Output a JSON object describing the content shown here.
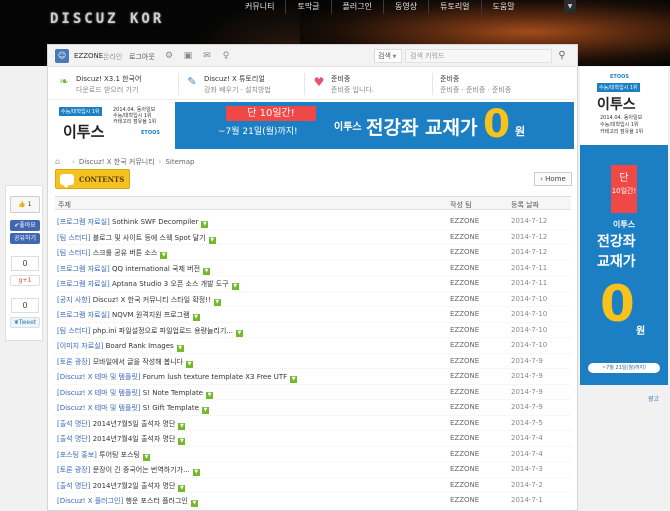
{
  "logo": "DISCUZ KOR",
  "topnav": {
    "items": [
      "커뮤니티",
      "토막글",
      "플러그인",
      "동영상",
      "튜토리얼",
      "도움말"
    ]
  },
  "toolbar": {
    "username": "EZZONE",
    "status": "온라인",
    "logout": "로그아웃",
    "search_scope": "검색",
    "search_placeholder": "검색 키워드"
  },
  "infobar": [
    {
      "title": "Discuz! X3.1 한국어",
      "subtitle": "다운로드 받으러 가기",
      "icon": "leaf-icon",
      "color": "#6cb33e"
    },
    {
      "title": "Discuz! X 튜토리얼",
      "subtitle": "강좌 배우기 · 설치방법",
      "icon": "chat-icon",
      "color": "#3f82c4"
    },
    {
      "title": "준비중",
      "subtitle": "준비중 입니다.",
      "icon": "heart-icon",
      "color": "#e8536b"
    },
    {
      "title": "준비중",
      "subtitle": "준비중 · 준비중 · 준비중"
    }
  ],
  "banner": {
    "badge": "수능/대학입시 1위",
    "year_line1": "2014.04. 동아일보",
    "year_line2": "수능/대학입시 1위",
    "year_line3": "카테고리 점유율 1위",
    "brand": "이투스",
    "etoos_small": "ETOOS",
    "ribbon_top": "단 10일간!",
    "ribbon_bottom": "~7월 21일(월)까지!",
    "brand2": "이투스",
    "headline": "전강좌 교재가",
    "zero": "0",
    "won": "원"
  },
  "side_ad": {
    "etoos_small": "ETOOS",
    "badge": "수능/대학입시 1위",
    "brand": "이투스",
    "year_line1": "2014.04. 동아일보",
    "year_line2": "수능/대학입시 1위",
    "year_line3": "카테고리 점유율 1위",
    "ribbon1": "단",
    "ribbon2": "10일간!",
    "brand2": "이투스",
    "headline1": "전강좌",
    "headline2": "교재가",
    "zero": "0",
    "won": "원",
    "deadline": "~7월 21일(월)까지!",
    "link": "광고"
  },
  "breadcrumb": [
    "Discuz! X 한국 커뮤니티",
    "Sitemap"
  ],
  "contents_label": "CONTENTS",
  "home_label": "Home",
  "share": {
    "like_count": "1",
    "like_label": "좋아요",
    "share_label": "공유하기",
    "gplus_count": "0",
    "gplus_label": "+1",
    "tweet_count": "0",
    "tweet_label": "Tweet"
  },
  "list": {
    "headers": {
      "subject": "주제",
      "author": "작성 팀",
      "date": "등록 날짜"
    },
    "rows": [
      {
        "cat": "[프로그램 자료실]",
        "title": "Sothink SWF Decompiler",
        "author": "EZZONE",
        "date": "2014-7-12"
      },
      {
        "cat": "[팀 스터디]",
        "title": "블로그 및 사이트 등에 스웩 Spot 달기",
        "author": "EZZONE",
        "date": "2014-7-12"
      },
      {
        "cat": "[팀 스터디]",
        "title": "스크롤 공유 버튼 소스",
        "author": "EZZONE",
        "date": "2014-7-12"
      },
      {
        "cat": "[프로그램 자료실]",
        "title": "QQ international 국제 버전",
        "author": "EZZONE",
        "date": "2014-7-11"
      },
      {
        "cat": "[프로그램 자료실]",
        "title": "Aptana Studio 3 오픈 소스 개발 도구",
        "author": "EZZONE",
        "date": "2014-7-11"
      },
      {
        "cat": "[공지 사항]",
        "title": "Discuz! X 한국 커뮤니티 스타일 확정!!",
        "author": "EZZONE",
        "date": "2014-7-10"
      },
      {
        "cat": "[프로그램 자료실]",
        "title": "NQVM 원격지원 프로그램",
        "author": "EZZONE",
        "date": "2014-7-10"
      },
      {
        "cat": "[팀 스터디]",
        "title": "php.ini 파일설정으로 파일업로드 용량늘리기...",
        "author": "EZZONE",
        "date": "2014-7-10"
      },
      {
        "cat": "[이미지 자료실]",
        "title": "Board Rank Images",
        "author": "EZZONE",
        "date": "2014-7-10"
      },
      {
        "cat": "[토론 광장]",
        "title": "모바일에서 글을 작성해 봅니다",
        "author": "EZZONE",
        "date": "2014-7-9"
      },
      {
        "cat": "[Discuz! X 테마 및 템플릿]",
        "title": "Forum lush texture template X3 Free UTF",
        "author": "EZZONE",
        "date": "2014-7-9"
      },
      {
        "cat": "[Discuz! X 테마 및 템플릿]",
        "title": "S! Note Template",
        "author": "EZZONE",
        "date": "2014-7-9"
      },
      {
        "cat": "[Discuz! X 테마 및 템플릿]",
        "title": "S! Gift Template",
        "author": "EZZONE",
        "date": "2014-7-9"
      },
      {
        "cat": "[출석 명단]",
        "title": "2014년7월5일 출석자 명단",
        "author": "EZZONE",
        "date": "2014-7-5"
      },
      {
        "cat": "[출석 명단]",
        "title": "2014년7월4일 출석자 명단",
        "author": "EZZONE",
        "date": "2014-7-4"
      },
      {
        "cat": "[포스팅 홍보]",
        "title": "투어팅 포스팅",
        "author": "EZZONE",
        "date": "2014-7-4"
      },
      {
        "cat": "[토론 광장]",
        "title": "문장이 긴 중국어는 번역하기가...",
        "author": "EZZONE",
        "date": "2014-7-3"
      },
      {
        "cat": "[출석 명단]",
        "title": "2014년7월2일 출석자 명단",
        "author": "EZZONE",
        "date": "2014-7-2"
      },
      {
        "cat": "[Discuz! X 플러그인]",
        "title": "행운 포스터 플러그인",
        "author": "EZZONE",
        "date": "2014-7-1"
      }
    ]
  }
}
